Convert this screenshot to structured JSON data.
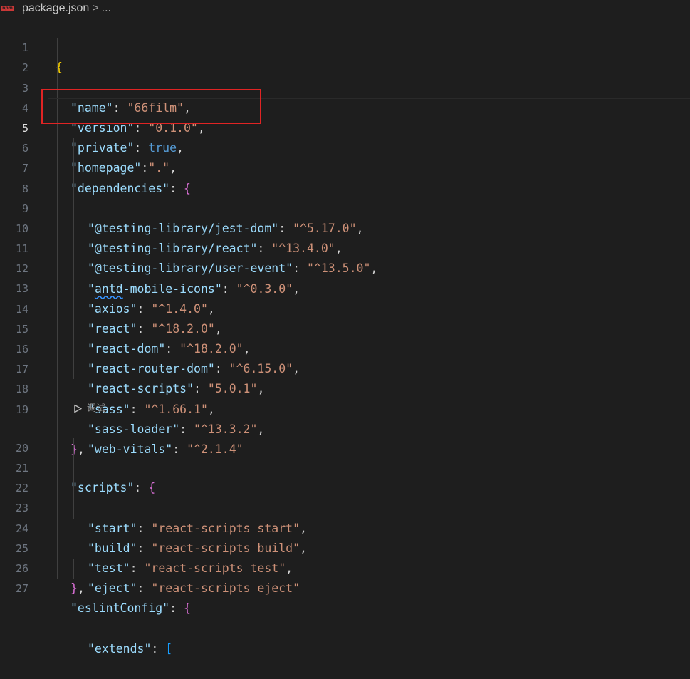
{
  "breadcrumb": {
    "file": "package.json",
    "separator": ">",
    "ellipsis": "...",
    "icon": "npm-icon",
    "icon_text": "npm"
  },
  "colors": {
    "background": "#1e1e1e",
    "key": "#9cdcfe",
    "string": "#ce9178",
    "keyword": "#569cd6",
    "bracket_level1": "#ffd700",
    "bracket_level2": "#da70d6",
    "bracket_level3": "#179fff",
    "highlight_box": "#e02424"
  },
  "editor": {
    "current_line": 5,
    "lines": [
      {
        "n": "1"
      },
      {
        "n": "2",
        "key": "\"name\"",
        "val": "\"66film\""
      },
      {
        "n": "3",
        "key": "\"version\"",
        "val": "\"0.1.0\""
      },
      {
        "n": "4",
        "key": "\"private\"",
        "val": "true"
      },
      {
        "n": "5",
        "key": "\"homepage\"",
        "val": "\".\""
      },
      {
        "n": "6",
        "key": "\"dependencies\""
      },
      {
        "n": "7",
        "key": "\"@testing-library/jest-dom\"",
        "val": "\"^5.17.0\""
      },
      {
        "n": "8",
        "key": "\"@testing-library/react\"",
        "val": "\"^13.4.0\""
      },
      {
        "n": "9",
        "key": "\"@testing-library/user-event\"",
        "val": "\"^13.5.0\""
      },
      {
        "n": "10",
        "key_pre": "\"",
        "key_sq": "antd",
        "key_post": "-mobile-icons\"",
        "val": "\"^0.3.0\""
      },
      {
        "n": "11",
        "key": "\"axios\"",
        "val": "\"^1.4.0\""
      },
      {
        "n": "12",
        "key": "\"react\"",
        "val": "\"^18.2.0\""
      },
      {
        "n": "13",
        "key": "\"react-dom\"",
        "val": "\"^18.2.0\""
      },
      {
        "n": "14",
        "key": "\"react-router-dom\"",
        "val": "\"^6.15.0\""
      },
      {
        "n": "15",
        "key": "\"react-scripts\"",
        "val": "\"5.0.1\""
      },
      {
        "n": "16",
        "key": "\"sass\"",
        "val": "\"^1.66.1\""
      },
      {
        "n": "17",
        "key": "\"sass-loader\"",
        "val": "\"^13.3.2\""
      },
      {
        "n": "18",
        "key": "\"web-vitals\"",
        "val": "\"^2.1.4\""
      },
      {
        "n": "19"
      },
      {
        "n": "20",
        "key": "\"scripts\""
      },
      {
        "n": "21",
        "key": "\"start\"",
        "val": "\"react-scripts start\""
      },
      {
        "n": "22",
        "key": "\"build\"",
        "val": "\"react-scripts build\""
      },
      {
        "n": "23",
        "key": "\"test\"",
        "val": "\"react-scripts test\""
      },
      {
        "n": "24",
        "key": "\"eject\"",
        "val": "\"react-scripts eject\""
      },
      {
        "n": "25"
      },
      {
        "n": "26",
        "key": "\"eslintConfig\""
      },
      {
        "n": "27",
        "key": "\"extends\""
      }
    ],
    "codelens": {
      "label": "调试",
      "icon": "play-outline-icon"
    }
  }
}
